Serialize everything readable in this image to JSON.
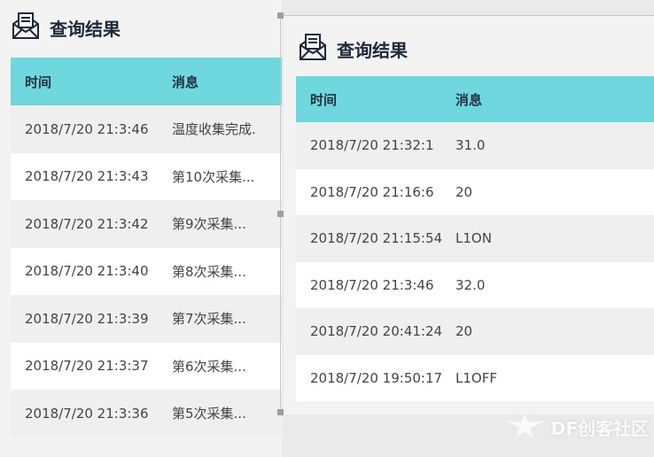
{
  "left_panel": {
    "title": "查询结果",
    "columns": [
      "时间",
      "消息"
    ],
    "rows": [
      {
        "time": "2018/7/20 21:3:46",
        "message": "温度收集完成."
      },
      {
        "time": "2018/7/20 21:3:43",
        "message": "第10次采集..."
      },
      {
        "time": "2018/7/20 21:3:42",
        "message": "第9次采集..."
      },
      {
        "time": "2018/7/20 21:3:40",
        "message": "第8次采集..."
      },
      {
        "time": "2018/7/20 21:3:39",
        "message": "第7次采集..."
      },
      {
        "time": "2018/7/20 21:3:37",
        "message": "第6次采集..."
      },
      {
        "time": "2018/7/20 21:3:36",
        "message": "第5次采集..."
      }
    ]
  },
  "right_panel": {
    "title": "查询结果",
    "columns": [
      "时间",
      "消息"
    ],
    "rows": [
      {
        "time": "2018/7/20 21:32:1",
        "message": "31.0"
      },
      {
        "time": "2018/7/20 21:16:6",
        "message": "20"
      },
      {
        "time": "2018/7/20 21:15:54",
        "message": "L1ON"
      },
      {
        "time": "2018/7/20 21:3:46",
        "message": "32.0"
      },
      {
        "time": "2018/7/20 20:41:24",
        "message": "20"
      },
      {
        "time": "2018/7/20 19:50:17",
        "message": "L1OFF"
      }
    ]
  },
  "watermark": {
    "text": "DF创客社区"
  },
  "colors": {
    "header_bg": "#6fd8df",
    "row_odd": "#efefef",
    "row_even": "#ffffff"
  },
  "icons": {
    "panel_header": "mail-list-icon",
    "watermark": "bird-logo-icon"
  }
}
